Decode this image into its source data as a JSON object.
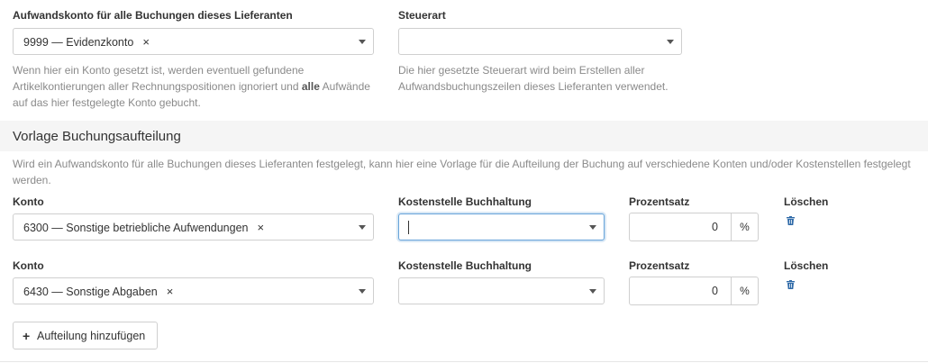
{
  "top": {
    "expense_account": {
      "label": "Aufwandskonto für alle Buchungen dieses Lieferanten",
      "value": "9999 — Evidenzkonto",
      "clear": "×",
      "help_part1": "Wenn hier ein Konto gesetzt ist, werden eventuell gefundene",
      "help_part2": "Artikelkontierungen aller Rechnungspositionen ignoriert und",
      "help_bold": "alle",
      "help_part3": "Aufwände",
      "help_part4": "auf das hier festgelegte Konto gebucht."
    },
    "tax_type": {
      "label": "Steuerart",
      "value": "",
      "help_line1": "Die hier gesetzte Steuerart wird beim Erstellen aller",
      "help_line2": "Aufwandsbuchungszeilen dieses Lieferanten verwendet."
    }
  },
  "section": {
    "title": "Vorlage Buchungsaufteilung",
    "help_line1": "Wird ein Aufwandskonto für alle Buchungen dieses Lieferanten festgelegt, kann hier eine Vorlage für die Aufteilung der Buchung auf verschiedene Konten und/oder Kostenstellen festgelegt",
    "help_line2": "werden."
  },
  "rows": [
    {
      "konto_label": "Konto",
      "konto_value": "6300 — Sonstige betriebliche Aufwendungen",
      "clear": "×",
      "kostenstelle_label": "Kostenstelle Buchhaltung",
      "kostenstelle_value": "",
      "prozent_label": "Prozentsatz",
      "prozent_value": "0",
      "prozent_unit": "%",
      "delete_label": "Löschen"
    },
    {
      "konto_label": "Konto",
      "konto_value": "6430 — Sonstige Abgaben",
      "clear": "×",
      "kostenstelle_label": "Kostenstelle Buchhaltung",
      "kostenstelle_value": "",
      "prozent_label": "Prozentsatz",
      "prozent_value": "0",
      "prozent_unit": "%",
      "delete_label": "Löschen"
    }
  ],
  "add_button": {
    "icon": "plus-icon",
    "label": "Aufteilung hinzufügen"
  },
  "colors": {
    "trash": "#2f6aa8",
    "focus_border": "#66a3d9",
    "band": "#f5f5f5"
  }
}
